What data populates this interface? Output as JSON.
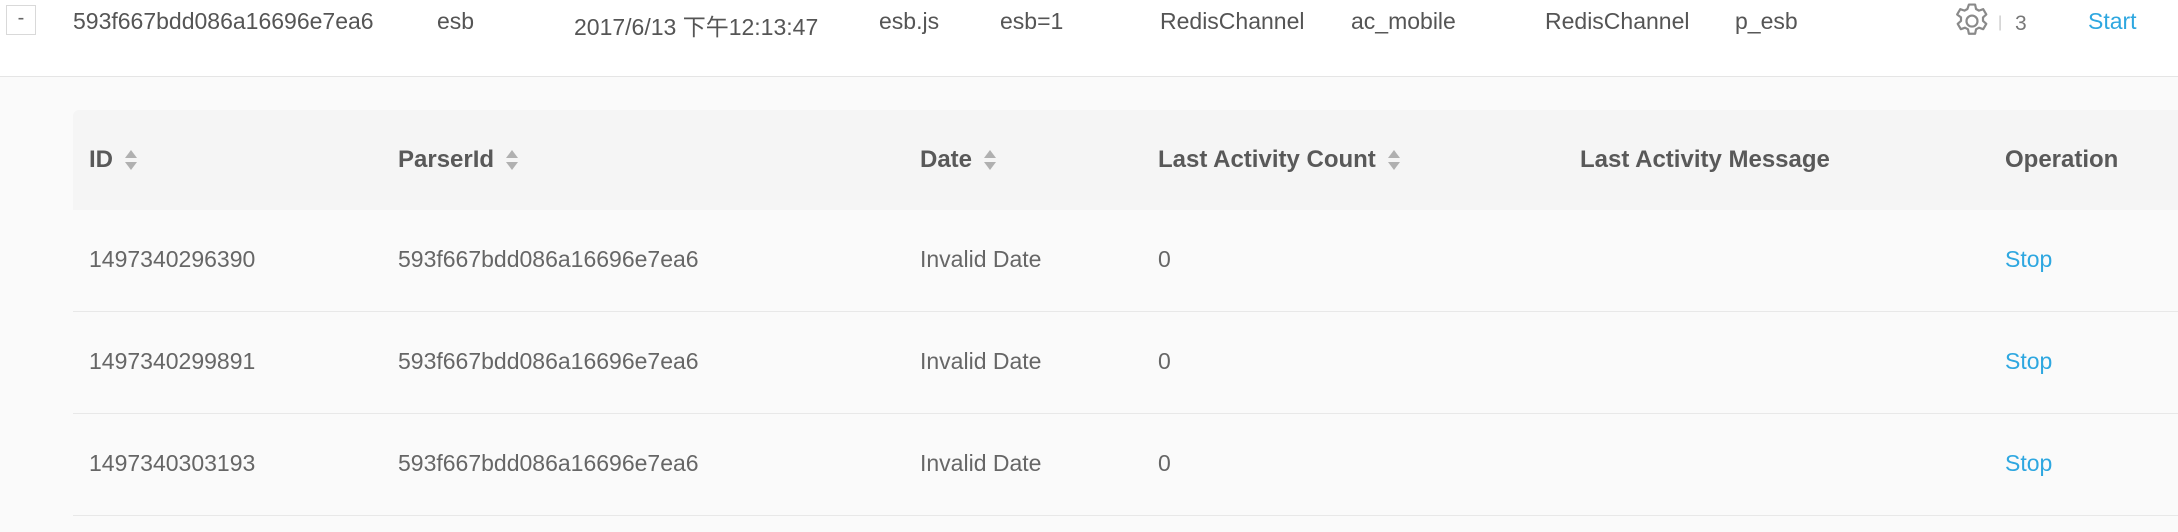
{
  "parent_row": {
    "expand_symbol": "-",
    "id": "593f667bdd086a16696e7ea6",
    "name": "esb",
    "date": "2017/6/13 下午12:13:47",
    "script": "esb.js",
    "param": "esb=1",
    "input_channel": "RedisChannel",
    "input_topic": "ac_mobile",
    "output_channel": "RedisChannel",
    "output_topic": "p_esb",
    "settings_icon": "gear-icon",
    "instance_count": "3",
    "start_label": "Start",
    "separator": "|"
  },
  "sub_table": {
    "headers": {
      "id": "ID",
      "parser_id": "ParserId",
      "date": "Date",
      "last_activity_count": "Last Activity Count",
      "last_activity_message": "Last Activity Message",
      "operation": "Operation"
    },
    "rows": [
      {
        "id": "1497340296390",
        "parser_id": "593f667bdd086a16696e7ea6",
        "date": "Invalid Date",
        "count": "0",
        "message": "",
        "operation": "Stop"
      },
      {
        "id": "1497340299891",
        "parser_id": "593f667bdd086a16696e7ea6",
        "date": "Invalid Date",
        "count": "0",
        "message": "",
        "operation": "Stop"
      },
      {
        "id": "1497340303193",
        "parser_id": "593f667bdd086a16696e7ea6",
        "date": "Invalid Date",
        "count": "0",
        "message": "",
        "operation": "Stop"
      }
    ]
  },
  "colors": {
    "link": "#2ea7e0",
    "header_bg": "#f5f5f5",
    "page_bg": "#fafafa"
  }
}
